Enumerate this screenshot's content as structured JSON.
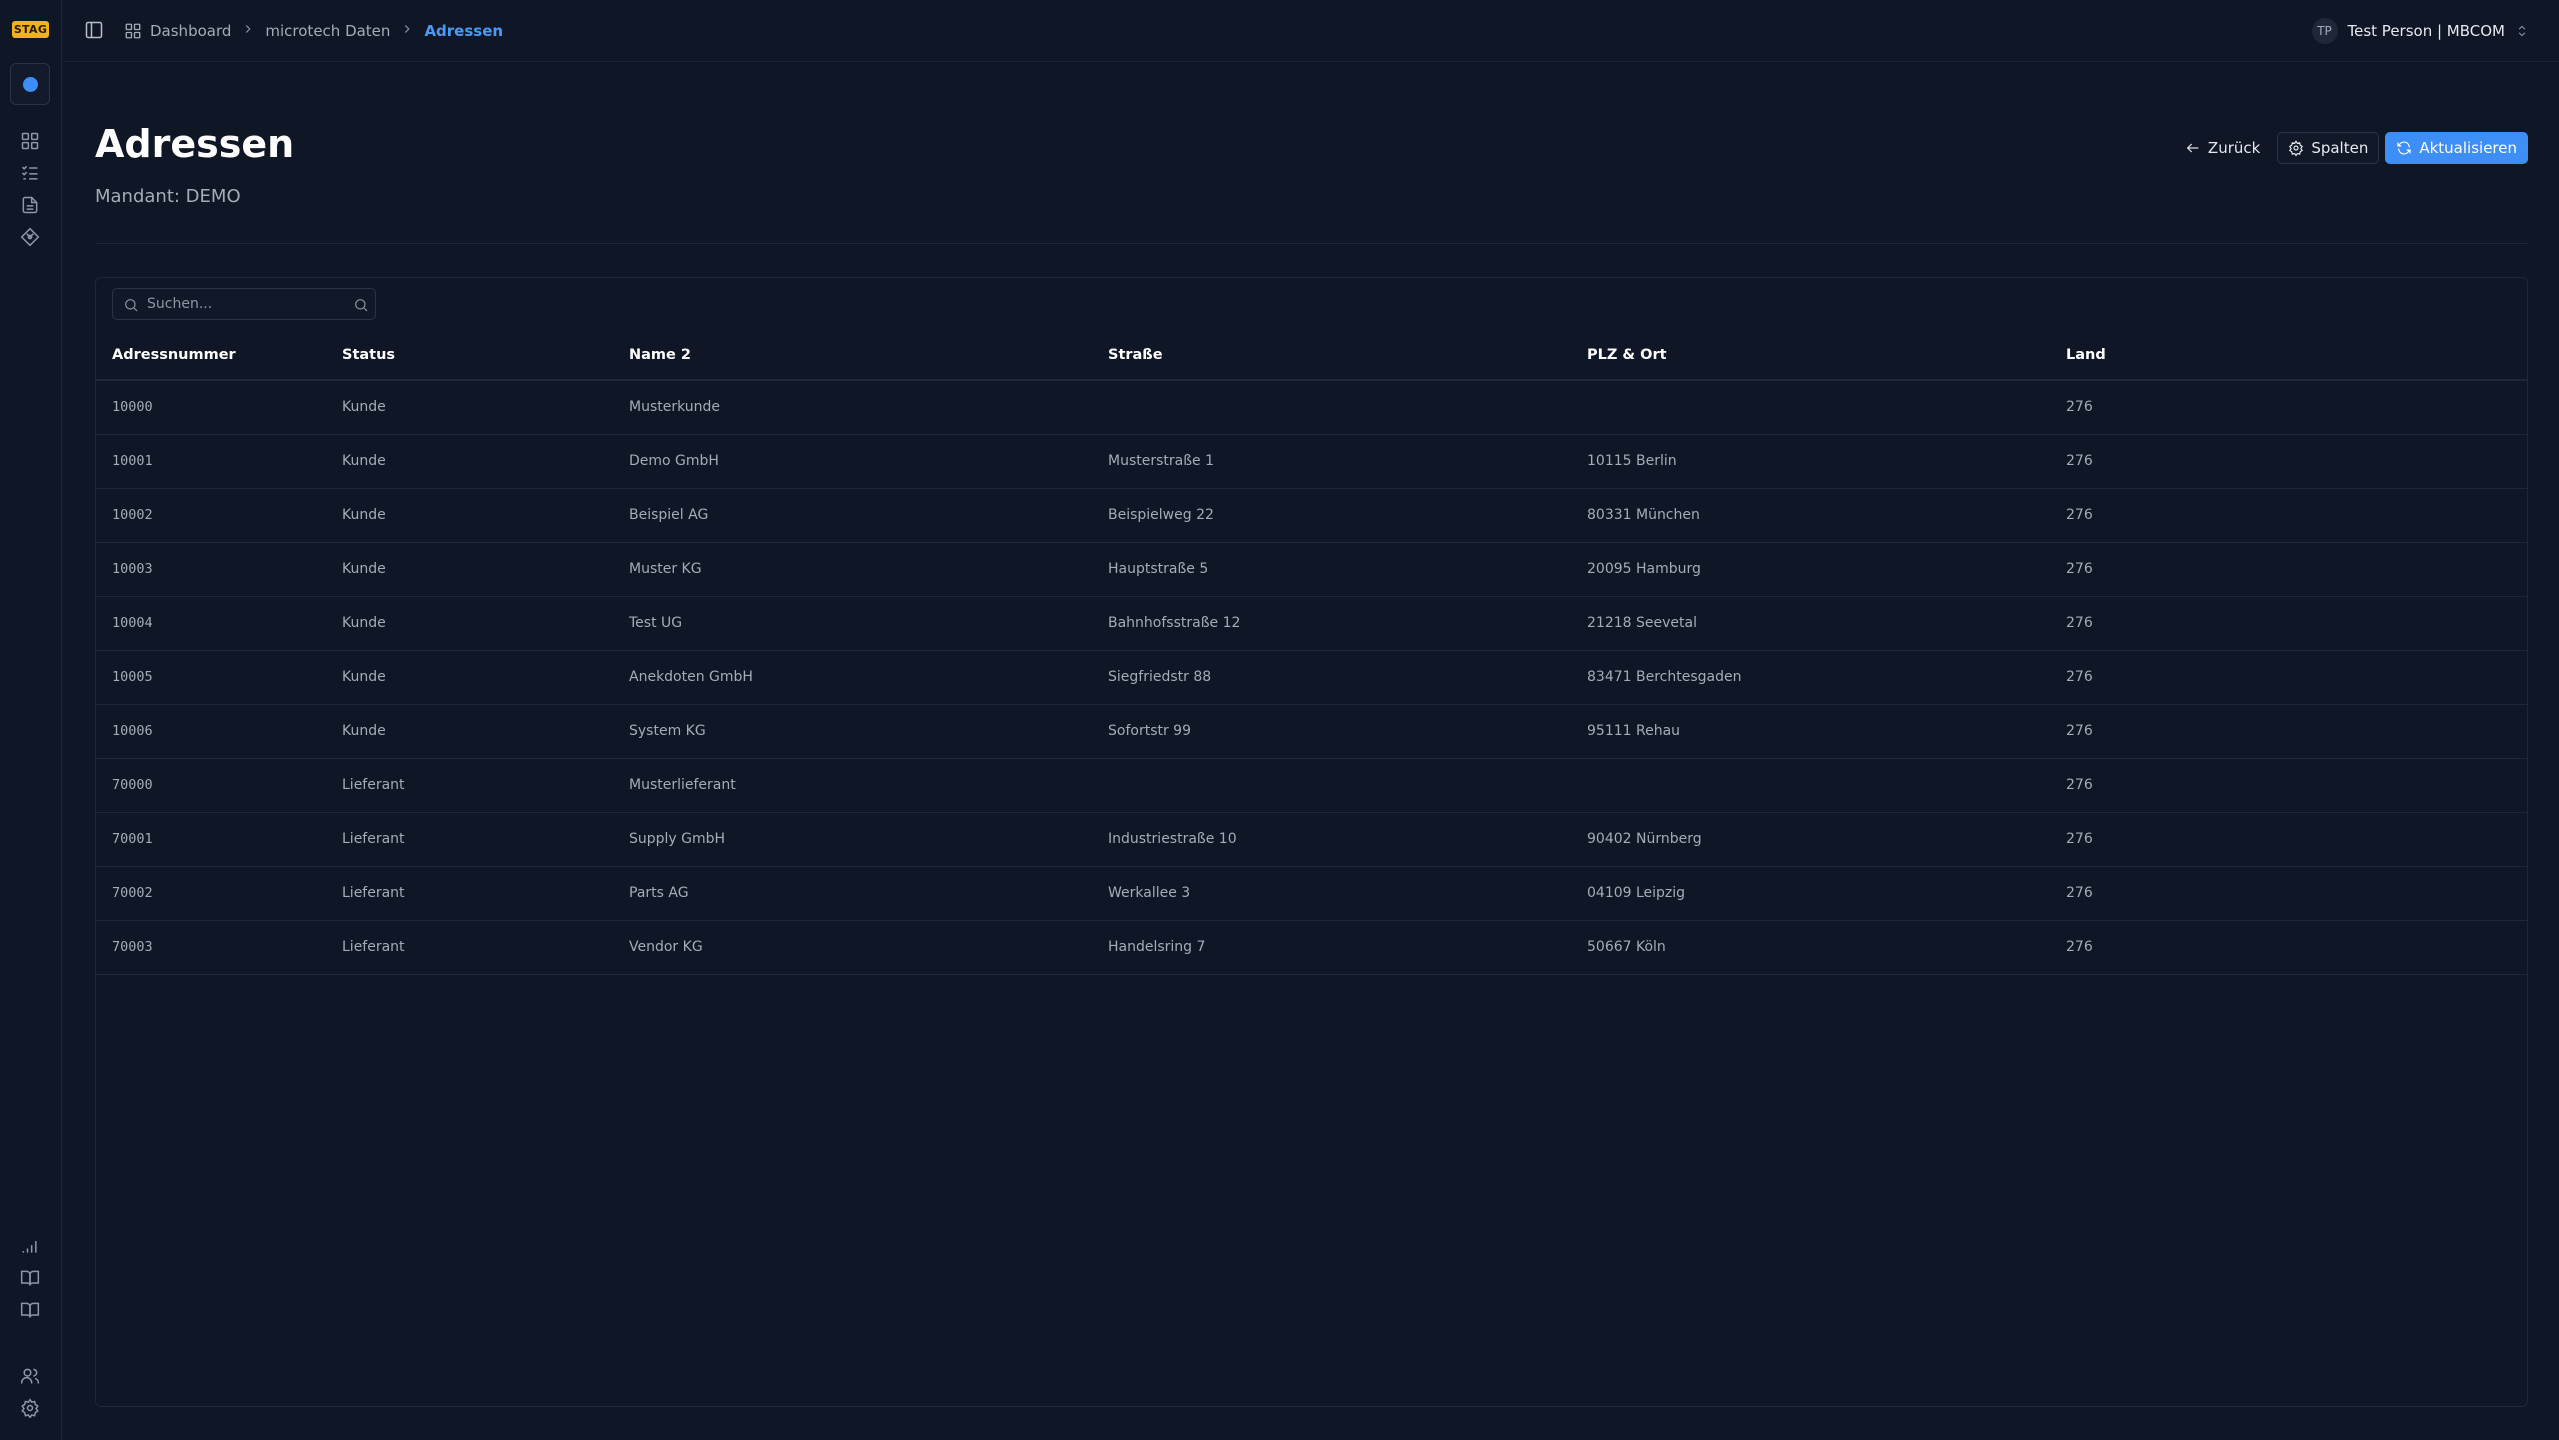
{
  "env_badge": "STAG",
  "breadcrumb": {
    "items": [
      "Dashboard",
      "microtech Daten"
    ],
    "active": "Adressen"
  },
  "user": {
    "initials": "TP",
    "name": "Test Person | MBCOM"
  },
  "page": {
    "title": "Adressen",
    "subtitle": "Mandant: DEMO"
  },
  "actions": {
    "back": "Zurück",
    "columns": "Spalten",
    "refresh": "Aktualisieren"
  },
  "search": {
    "placeholder": "Suchen..."
  },
  "table": {
    "headers": [
      "Adressnummer",
      "Status",
      "Name 2",
      "Straße",
      "PLZ & Ort",
      "Land"
    ],
    "rows": [
      [
        "10000",
        "Kunde",
        "Musterkunde",
        "",
        "",
        "276"
      ],
      [
        "10001",
        "Kunde",
        "Demo GmbH",
        "Musterstraße 1",
        "10115 Berlin",
        "276"
      ],
      [
        "10002",
        "Kunde",
        "Beispiel AG",
        "Beispielweg 22",
        "80331 München",
        "276"
      ],
      [
        "10003",
        "Kunde",
        "Muster KG",
        "Hauptstraße 5",
        "20095 Hamburg",
        "276"
      ],
      [
        "10004",
        "Kunde",
        "Test UG",
        "Bahnhofsstraße 12",
        "21218 Seevetal",
        "276"
      ],
      [
        "10005",
        "Kunde",
        "Anekdoten GmbH",
        "Siegfriedstr 88",
        "83471 Berchtesgaden",
        "276"
      ],
      [
        "10006",
        "Kunde",
        "System KG",
        "Sofortstr 99",
        "95111 Rehau",
        "276"
      ],
      [
        "70000",
        "Lieferant",
        "Musterlieferant",
        "",
        "",
        "276"
      ],
      [
        "70001",
        "Lieferant",
        "Supply GmbH",
        "Industriestraße 10",
        "90402 Nürnberg",
        "276"
      ],
      [
        "70002",
        "Lieferant",
        "Parts AG",
        "Werkallee 3",
        "04109 Leipzig",
        "276"
      ],
      [
        "70003",
        "Lieferant",
        "Vendor KG",
        "Handelsring 7",
        "50667 Köln",
        "276"
      ]
    ]
  },
  "sidebar_icons": [
    "dashboard-icon",
    "list-checks-icon",
    "file-text-icon",
    "git-diamond-icon",
    "signal-icon",
    "book-open-icon",
    "book-icon",
    "users-icon",
    "settings-icon"
  ],
  "colors": {
    "accent": "#3d8ef6",
    "badge": "#f2b21b",
    "background": "#0f1626"
  }
}
